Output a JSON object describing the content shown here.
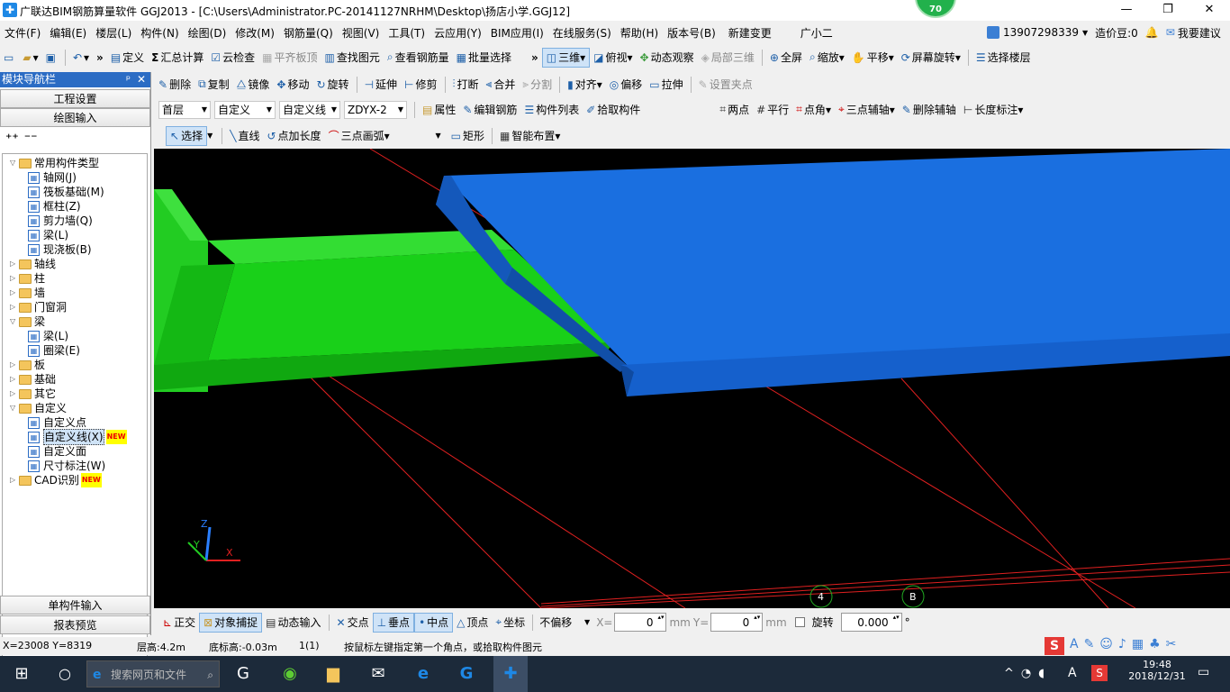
{
  "title": "广联达BIM钢筋算量软件 GGJ2013 - [C:\\Users\\Administrator.PC-20141127NRHM\\Desktop\\扬店小学.GGJ12]",
  "badge": "70",
  "window_controls": {
    "min": "—",
    "max": "❐",
    "close": "✕"
  },
  "menu": [
    "文件(F)",
    "编辑(E)",
    "楼层(L)",
    "构件(N)",
    "绘图(D)",
    "修改(M)",
    "钢筋量(Q)",
    "视图(V)",
    "工具(T)",
    "云应用(Y)",
    "BIM应用(I)",
    "在线服务(S)",
    "帮助(H)",
    "版本号(B)",
    "新建变更",
    "广小二"
  ],
  "account": {
    "phone": "13907298339",
    "price": "造价豆:0",
    "suggest": "我要建议"
  },
  "toolbar1": {
    "define": "定义",
    "summary": "汇总计算",
    "cloud_check": "云检查",
    "flat_board": "平齐板顶",
    "find": "查找图元",
    "view_rebar": "查看钢筋量",
    "batch": "批量选择",
    "view3d": "三维",
    "top_view": "俯视",
    "dynamic": "动态观察",
    "local3d": "局部三维",
    "full": "全屏",
    "zoom": "缩放",
    "pan": "平移",
    "rotate_screen": "屏幕旋转",
    "select_floor": "选择楼层"
  },
  "toolbar2": {
    "delete": "删除",
    "copy": "复制",
    "mirror": "镜像",
    "move": "移动",
    "rotate": "旋转",
    "extend": "延伸",
    "trim": "修剪",
    "break": "打断",
    "merge": "合并",
    "split": "分割",
    "align": "对齐",
    "offset": "偏移",
    "stretch": "拉伸",
    "set_grip": "设置夹点"
  },
  "toolbar3": {
    "floor": "首层",
    "category": "自定义",
    "type": "自定义线",
    "name": "ZDYX-2",
    "props": "属性",
    "edit_rebar": "编辑钢筋",
    "comp_list": "构件列表",
    "pick": "拾取构件",
    "two_points": "两点",
    "parallel": "平行",
    "point_angle": "点角",
    "three_axis": "三点辅轴",
    "del_axis": "删除辅轴",
    "length_dim": "长度标注"
  },
  "toolbar4": {
    "select": "选择",
    "line": "直线",
    "point_len": "点加长度",
    "arc": "三点画弧",
    "rect": "矩形",
    "smart": "智能布置"
  },
  "nav": {
    "header": "模块导航栏",
    "pin": "ᵖ",
    "close": "✕",
    "eng_settings": "工程设置",
    "drawing_input": "绘图输入",
    "single_input": "单构件输入",
    "report": "报表预览",
    "new_label": "NEW",
    "tree": [
      {
        "label": "常用构件类型",
        "level": 0,
        "kind": "folder",
        "open": true
      },
      {
        "label": "轴网(J)",
        "level": 1,
        "kind": "item"
      },
      {
        "label": "筏板基础(M)",
        "level": 1,
        "kind": "item"
      },
      {
        "label": "框柱(Z)",
        "level": 1,
        "kind": "item"
      },
      {
        "label": "剪力墙(Q)",
        "level": 1,
        "kind": "item"
      },
      {
        "label": "梁(L)",
        "level": 1,
        "kind": "item"
      },
      {
        "label": "现浇板(B)",
        "level": 1,
        "kind": "item"
      },
      {
        "label": "轴线",
        "level": 0,
        "kind": "folder",
        "open": false
      },
      {
        "label": "柱",
        "level": 0,
        "kind": "folder",
        "open": false
      },
      {
        "label": "墙",
        "level": 0,
        "kind": "folder",
        "open": false
      },
      {
        "label": "门窗洞",
        "level": 0,
        "kind": "folder",
        "open": false
      },
      {
        "label": "梁",
        "level": 0,
        "kind": "folder",
        "open": true
      },
      {
        "label": "梁(L)",
        "level": 1,
        "kind": "item"
      },
      {
        "label": "圈梁(E)",
        "level": 1,
        "kind": "item"
      },
      {
        "label": "板",
        "level": 0,
        "kind": "folder",
        "open": false
      },
      {
        "label": "基础",
        "level": 0,
        "kind": "folder",
        "open": false
      },
      {
        "label": "其它",
        "level": 0,
        "kind": "folder",
        "open": false
      },
      {
        "label": "自定义",
        "level": 0,
        "kind": "folder",
        "open": true
      },
      {
        "label": "自定义点",
        "level": 1,
        "kind": "item"
      },
      {
        "label": "自定义线(X)",
        "level": 1,
        "kind": "item",
        "selected": true,
        "new": true
      },
      {
        "label": "自定义面",
        "level": 1,
        "kind": "item"
      },
      {
        "label": "尺寸标注(W)",
        "level": 1,
        "kind": "item"
      },
      {
        "label": "CAD识别",
        "level": 0,
        "kind": "folder",
        "open": false,
        "new": true
      }
    ]
  },
  "viewport": {
    "axis_labels": {
      "x": "X",
      "y": "Y",
      "z": "Z"
    },
    "markers": [
      "4",
      "B"
    ]
  },
  "snapbar": {
    "ortho": "正交",
    "snap": "对象捕捉",
    "dyn_input": "动态输入",
    "intersect": "交点",
    "perp": "垂点",
    "mid": "中点",
    "vertex": "顶点",
    "coord": "坐标",
    "offset_mode": "不偏移",
    "x_label": "X=",
    "x_val": "0",
    "mm1": "mm",
    "y_label": "Y=",
    "y_val": "0",
    "mm2": "mm",
    "rotate": "旋转",
    "rotate_val": "0.000",
    "deg": "°"
  },
  "status": {
    "coords": "X=23008  Y=8319",
    "floor_h": "层高:4.2m",
    "base_h": "底标高:-0.03m",
    "count": "1(1)",
    "hint": "按鼠标左键指定第一个角点，或拾取构件图元"
  },
  "taskbar": {
    "search": "搜索网页和文件",
    "time": "19:48",
    "date": "2018/12/31",
    "ime": "A"
  },
  "colors": {
    "slab": "#1a6fe0",
    "beam": "#19d019",
    "grid": "#e02020",
    "nav_header": "#2b6cc4"
  }
}
